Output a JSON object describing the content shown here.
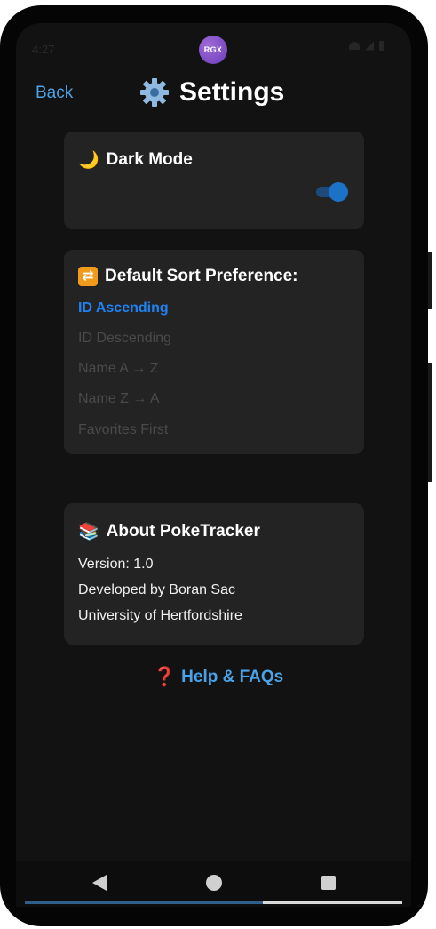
{
  "status": {
    "time": "4:27",
    "avatar_text": "RGX"
  },
  "header": {
    "back_label": "Back",
    "title": "Settings",
    "title_icon": "gear-icon"
  },
  "dark_mode": {
    "emoji": "🌙",
    "label": "Dark Mode",
    "enabled": true
  },
  "sort": {
    "emoji": "🔁",
    "label": "Default Sort Preference:",
    "selected": "ID Ascending",
    "options": [
      {
        "label": "ID Ascending",
        "active": true
      },
      {
        "label": "ID Descending",
        "active": false
      },
      {
        "label": "Name A → Z",
        "active": false
      },
      {
        "label": "Name Z → A",
        "active": false
      },
      {
        "label": "Favorites First",
        "active": false
      }
    ]
  },
  "about": {
    "emoji": "📚",
    "title": "About PokeTracker",
    "lines": [
      "Version: 1.0",
      "Developed by Boran Sac",
      "University of Hertfordshire"
    ]
  },
  "help": {
    "emoji": "❓",
    "label": "Help & FAQs"
  },
  "system_nav": {
    "back_icon": "triangle-back-icon",
    "home_icon": "circle-home-icon",
    "recents_icon": "square-recents-icon",
    "progress": 0.63
  },
  "colors": {
    "accent": "#1e82f0",
    "link": "#4aa3e8",
    "card": "#232323",
    "background": "#121212"
  }
}
